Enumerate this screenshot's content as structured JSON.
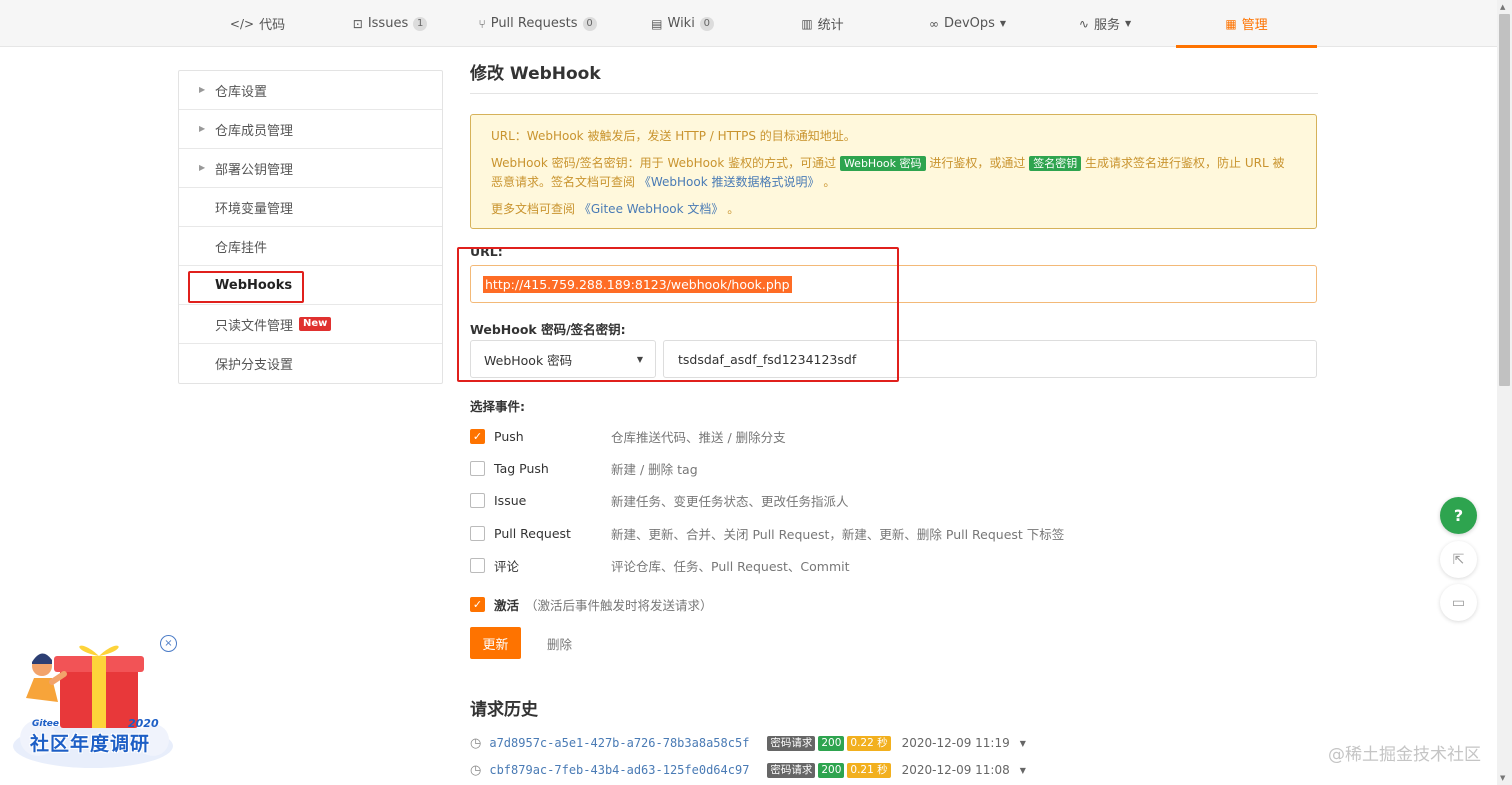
{
  "nav": {
    "tabs": [
      {
        "label": "代码",
        "icon": "code-icon"
      },
      {
        "label": "Issues",
        "badge": "1",
        "icon": "issue-icon"
      },
      {
        "label": "Pull Requests",
        "badge": "0",
        "icon": "pull-request-icon"
      },
      {
        "label": "Wiki",
        "badge": "0",
        "icon": "book-icon"
      },
      {
        "label": "统计",
        "icon": "bar-chart-icon"
      },
      {
        "label": "DevOps",
        "icon": "infinity-icon"
      },
      {
        "label": "服务",
        "icon": "pulse-icon"
      },
      {
        "label": "管理",
        "icon": "document-icon",
        "active": true
      }
    ],
    "active_color": "#fe7300"
  },
  "sidebar": {
    "items": [
      {
        "label": "仓库设置"
      },
      {
        "label": "仓库成员管理"
      },
      {
        "label": "部署公钥管理"
      },
      {
        "label": "环境变量管理"
      },
      {
        "label": "仓库挂件"
      },
      {
        "label": "WebHooks",
        "active": true
      },
      {
        "label": "只读文件管理",
        "badge": "New"
      },
      {
        "label": "保护分支设置"
      }
    ]
  },
  "main": {
    "title": "修改 WebHook",
    "notice": {
      "line1": "URL：WebHook 被触发后，发送 HTTP / HTTPS 的目标通知地址。",
      "line2_a": "WebHook 密码/签名密钥：用于 WebHook 鉴权的方式，可通过",
      "tag_password": "WebHook 密码",
      "line2_b": "进行鉴权，或通过",
      "tag_sign": "签名密钥",
      "line2_c": "生成请求签名进行鉴权，防止 URL 被恶意请求。签名文档可查阅",
      "doc_link1": "《WebHook 推送数据格式说明》",
      "period": "。",
      "line3_a": "更多文档可查阅",
      "doc_link2": "《Gitee WebHook 文档》",
      "period2": "。"
    },
    "url_label": "URL:",
    "url_value": "http://415.759.288.189:8123/webhook/hook.php",
    "secret_label": "WebHook 密码/签名密钥:",
    "secret_type": "WebHook 密码",
    "secret_value": "tsdsdaf_asdf_fsd1234123sdf",
    "events_label": "选择事件:",
    "events": [
      {
        "name": "Push",
        "desc": "仓库推送代码、推送 / 删除分支",
        "checked": true
      },
      {
        "name": "Tag Push",
        "desc": "新建 / 删除 tag",
        "checked": false
      },
      {
        "name": "Issue",
        "desc": "新建任务、变更任务状态、更改任务指派人",
        "checked": false
      },
      {
        "name": "Pull Request",
        "desc": "新建、更新、合并、关闭 Pull Request，新建、更新、删除 Pull Request 下标签",
        "checked": false
      },
      {
        "name": "评论",
        "desc": "评论仓库、任务、Pull Request、Commit",
        "checked": false
      }
    ],
    "activate_label": "激活",
    "activate_hint": "（激活后事件触发时将发送请求）",
    "activate_checked": true,
    "update_button": "更新",
    "delete_button": "删除",
    "history_title": "请求历史",
    "history": [
      {
        "hash": "a7d8957c-a5e1-427b-a726-78b3a8a58c5f",
        "type": "密码请求",
        "status": "200",
        "duration": "0.22 秒",
        "time": "2020-12-09 11:19"
      },
      {
        "hash": "cbf879ac-7feb-43b4-ad63-125fe0d64c97",
        "type": "密码请求",
        "status": "200",
        "duration": "0.21 秒",
        "time": "2020-12-09 11:08"
      }
    ]
  },
  "floating": {
    "help": "?",
    "share_icon": "share-icon",
    "comment_icon": "comment-icon"
  },
  "promo": {
    "brand": "Gitee",
    "year": "2020",
    "title": "社区年度调研",
    "close": "×"
  },
  "watermark": "@稀土掘金技术社区"
}
